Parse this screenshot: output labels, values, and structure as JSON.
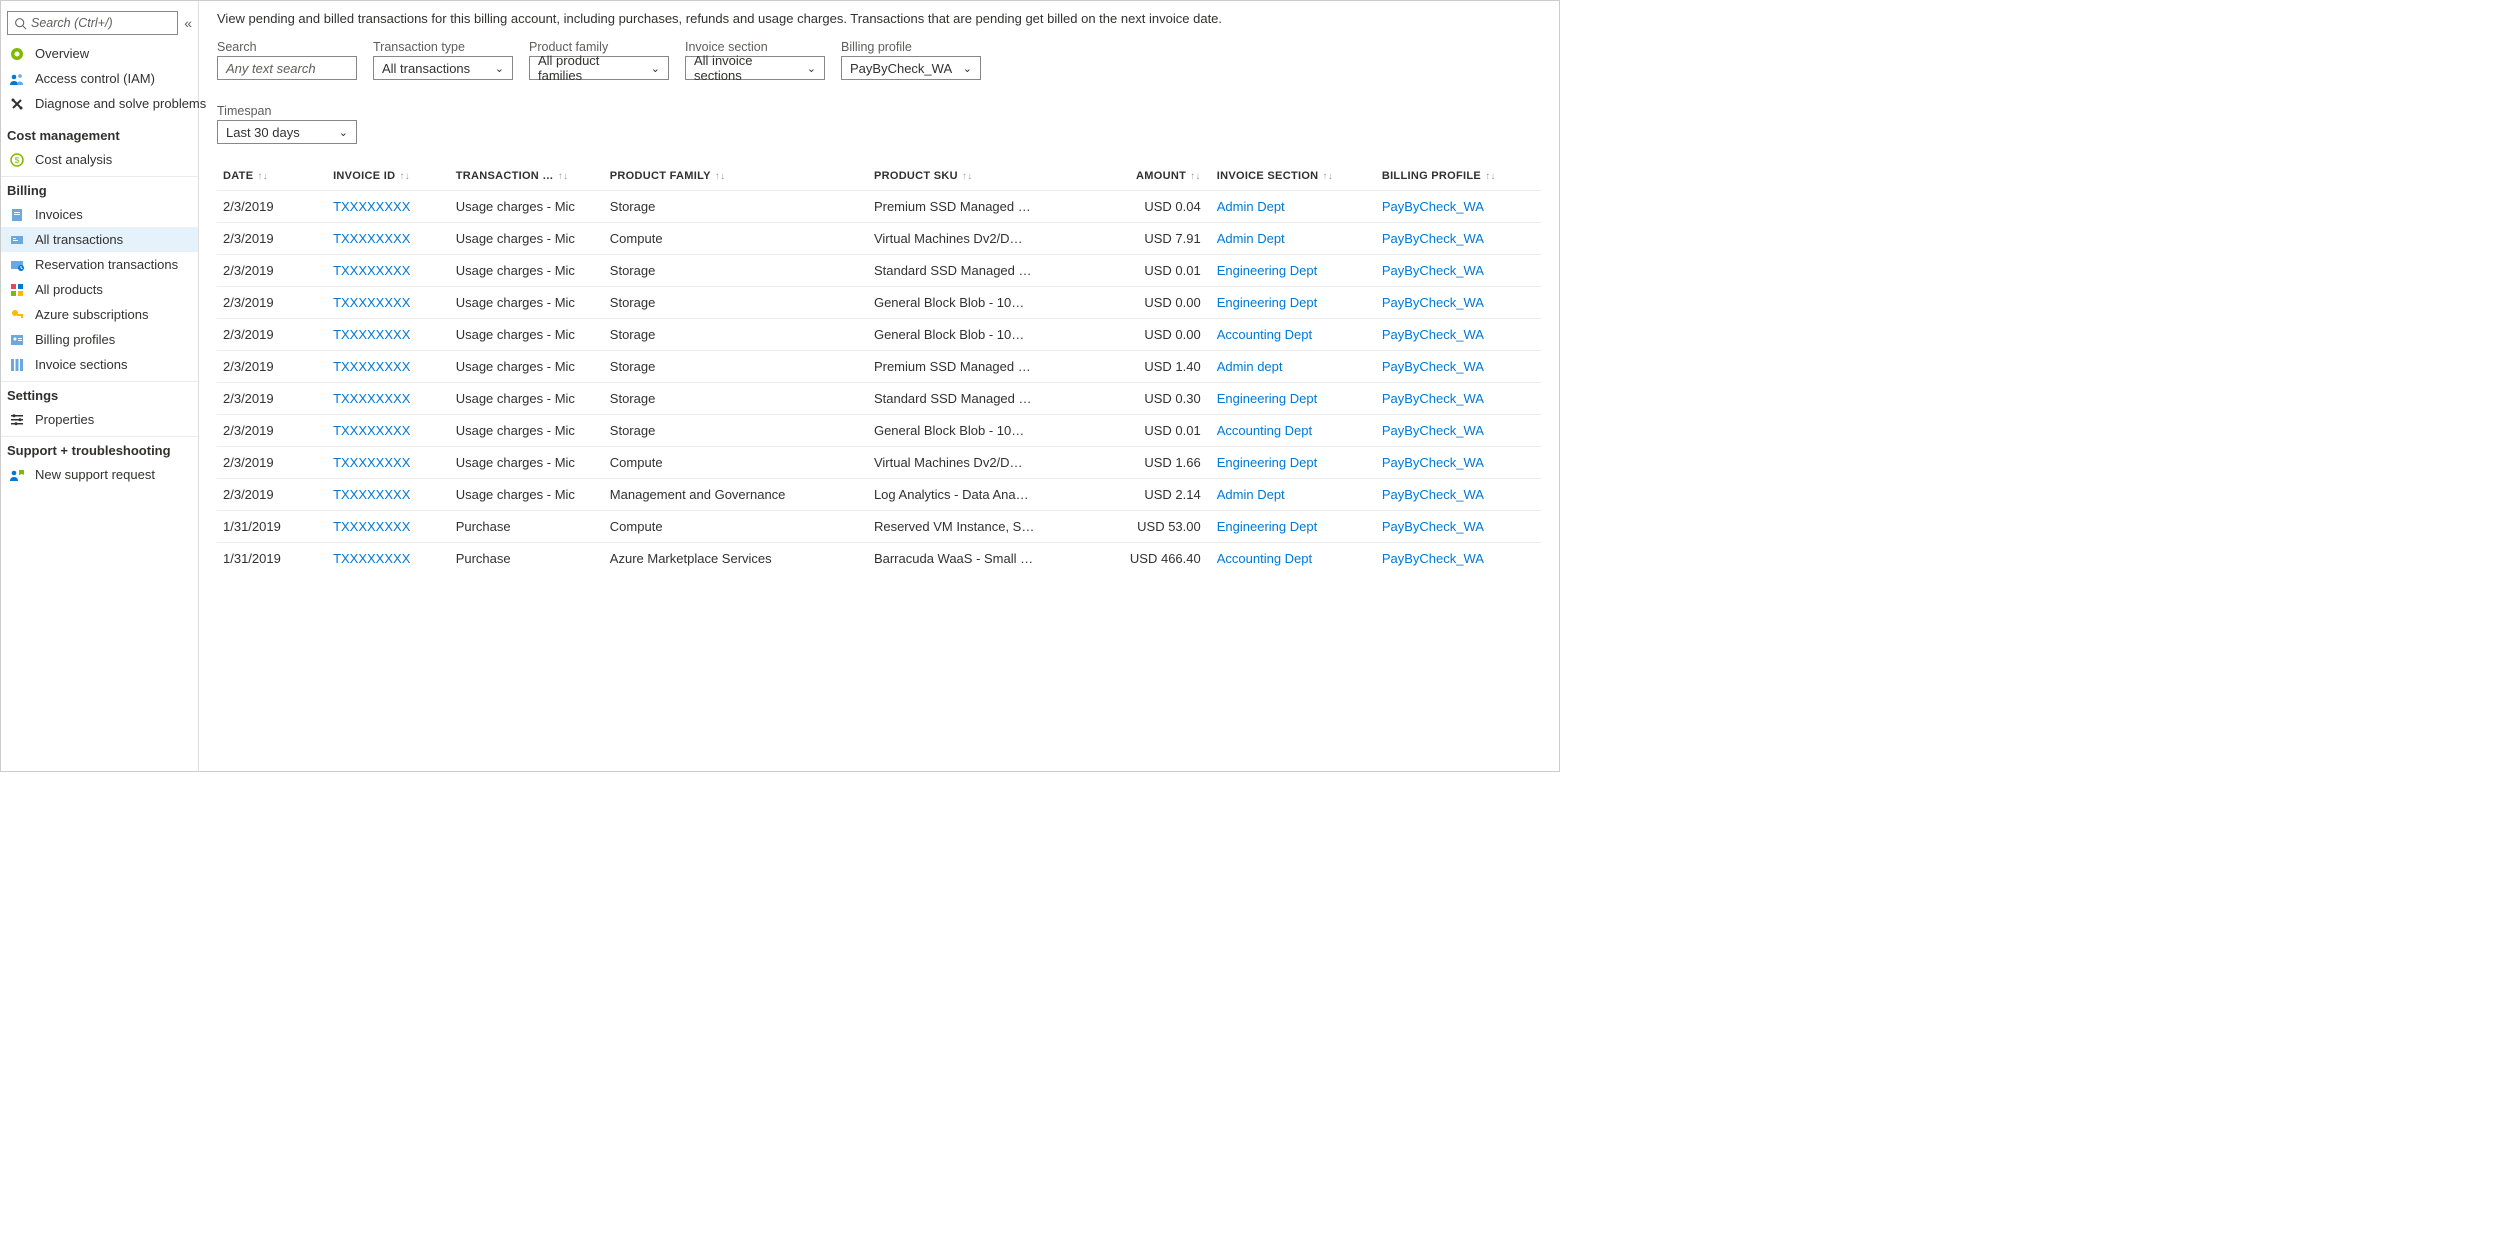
{
  "sidebar": {
    "search_placeholder": "Search (Ctrl+/)",
    "top": [
      {
        "label": "Overview",
        "icon": "overview"
      },
      {
        "label": "Access control (IAM)",
        "icon": "iam"
      },
      {
        "label": "Diagnose and solve problems",
        "icon": "diagnose"
      }
    ],
    "sections": [
      {
        "title": "Cost management",
        "items": [
          {
            "label": "Cost analysis",
            "icon": "cost"
          }
        ]
      },
      {
        "title": "Billing",
        "items": [
          {
            "label": "Invoices",
            "icon": "invoices"
          },
          {
            "label": "All transactions",
            "icon": "transactions",
            "active": true
          },
          {
            "label": "Reservation transactions",
            "icon": "reservation"
          },
          {
            "label": "All products",
            "icon": "products"
          },
          {
            "label": "Azure subscriptions",
            "icon": "key"
          },
          {
            "label": "Billing profiles",
            "icon": "profile"
          },
          {
            "label": "Invoice sections",
            "icon": "sections"
          }
        ]
      },
      {
        "title": "Settings",
        "items": [
          {
            "label": "Properties",
            "icon": "properties"
          }
        ]
      },
      {
        "title": "Support + troubleshooting",
        "items": [
          {
            "label": "New support request",
            "icon": "support"
          }
        ]
      }
    ]
  },
  "main": {
    "intro": "View pending and billed transactions for this billing account, including purchases, refunds and usage charges. Transactions that are pending get billed on the next invoice date.",
    "filters": {
      "search": {
        "label": "Search",
        "placeholder": "Any text search"
      },
      "transaction_type": {
        "label": "Transaction type",
        "value": "All transactions"
      },
      "product_family": {
        "label": "Product family",
        "value": "All product families"
      },
      "invoice_section": {
        "label": "Invoice section",
        "value": "All invoice sections"
      },
      "billing_profile": {
        "label": "Billing profile",
        "value": "PayByCheck_WA"
      },
      "timespan": {
        "label": "Timespan",
        "value": "Last 30 days"
      }
    },
    "columns": [
      "DATE",
      "INVOICE ID",
      "TRANSACTION …",
      "PRODUCT FAMILY",
      "PRODUCT SKU",
      "AMOUNT",
      "INVOICE SECTION",
      "BILLING PROFILE"
    ],
    "rows": [
      {
        "date": "2/3/2019",
        "invoice": "TXXXXXXXX",
        "trans": "Usage charges - Mic",
        "pf": "Storage",
        "sku": "Premium SSD Managed …",
        "amount": "USD 0.04",
        "sec": "Admin Dept",
        "bp": "PayByCheck_WA"
      },
      {
        "date": "2/3/2019",
        "invoice": "TXXXXXXXX",
        "trans": "Usage charges - Mic",
        "pf": "Compute",
        "sku": "Virtual Machines Dv2/D…",
        "amount": "USD 7.91",
        "sec": "Admin Dept",
        "bp": "PayByCheck_WA"
      },
      {
        "date": "2/3/2019",
        "invoice": "TXXXXXXXX",
        "trans": "Usage charges - Mic",
        "pf": "Storage",
        "sku": "Standard SSD Managed …",
        "amount": "USD 0.01",
        "sec": "Engineering Dept",
        "bp": "PayByCheck_WA"
      },
      {
        "date": "2/3/2019",
        "invoice": "TXXXXXXXX",
        "trans": "Usage charges - Mic",
        "pf": "Storage",
        "sku": "General Block Blob - 10…",
        "amount": "USD 0.00",
        "sec": "Engineering Dept",
        "bp": "PayByCheck_WA"
      },
      {
        "date": "2/3/2019",
        "invoice": "TXXXXXXXX",
        "trans": "Usage charges - Mic",
        "pf": "Storage",
        "sku": "General Block Blob - 10…",
        "amount": "USD 0.00",
        "sec": "Accounting Dept",
        "bp": "PayByCheck_WA"
      },
      {
        "date": "2/3/2019",
        "invoice": "TXXXXXXXX",
        "trans": "Usage charges - Mic",
        "pf": "Storage",
        "sku": "Premium SSD Managed …",
        "amount": "USD 1.40",
        "sec": "Admin dept",
        "bp": "PayByCheck_WA"
      },
      {
        "date": "2/3/2019",
        "invoice": "TXXXXXXXX",
        "trans": "Usage charges - Mic",
        "pf": "Storage",
        "sku": "Standard SSD Managed …",
        "amount": "USD 0.30",
        "sec": "Engineering Dept",
        "bp": "PayByCheck_WA"
      },
      {
        "date": "2/3/2019",
        "invoice": "TXXXXXXXX",
        "trans": "Usage charges - Mic",
        "pf": "Storage",
        "sku": "General Block Blob - 10…",
        "amount": "USD 0.01",
        "sec": "Accounting Dept",
        "bp": "PayByCheck_WA"
      },
      {
        "date": "2/3/2019",
        "invoice": "TXXXXXXXX",
        "trans": "Usage charges - Mic",
        "pf": "Compute",
        "sku": "Virtual Machines Dv2/D…",
        "amount": "USD 1.66",
        "sec": "Engineering Dept",
        "bp": "PayByCheck_WA"
      },
      {
        "date": "2/3/2019",
        "invoice": "TXXXXXXXX",
        "trans": "Usage charges - Mic",
        "pf": "Management and Governance",
        "sku": "Log Analytics - Data Ana…",
        "amount": "USD 2.14",
        "sec": "Admin Dept",
        "bp": "PayByCheck_WA"
      },
      {
        "date": "1/31/2019",
        "invoice": "TXXXXXXXX",
        "trans": "Purchase",
        "pf": "Compute",
        "sku": "Reserved VM Instance, S…",
        "amount": "USD 53.00",
        "sec": "Engineering Dept",
        "bp": "PayByCheck_WA"
      },
      {
        "date": "1/31/2019",
        "invoice": "TXXXXXXXX",
        "trans": "Purchase",
        "pf": "Azure Marketplace Services",
        "sku": "Barracuda WaaS - Small …",
        "amount": "USD 466.40",
        "sec": "Accounting Dept",
        "bp": "PayByCheck_WA"
      }
    ]
  }
}
